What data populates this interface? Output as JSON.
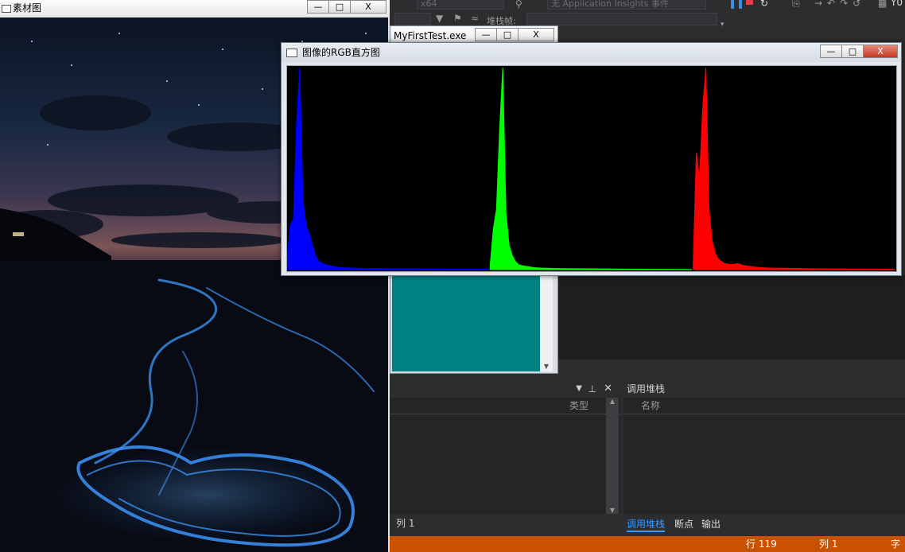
{
  "vs": {
    "platform": "x64",
    "insights": "无 Application Insights 事件",
    "stackframe_label": "堆栈帧:",
    "locals_col_type": "类型",
    "callstack_title": "调用堆栈",
    "callstack_col_name": "名称",
    "tabs": [
      "调用堆栈",
      "断点",
      "输出"
    ],
    "status_line": "行 119",
    "status_col": "列 1",
    "status_char": "字",
    "left_status": "列 1",
    "top_right_text": "Y0"
  },
  "console_window": {
    "title": "MyFirstTest.exe",
    "bg_color": "#008080"
  },
  "source_window": {
    "title": "素材图",
    "image_desc_icon": "beach-night-image"
  },
  "hist_window": {
    "title": "图像的RGB直方图",
    "colors": {
      "blue": "#0000ff",
      "green": "#00ff00",
      "red": "#ff0000"
    }
  },
  "window_buttons": {
    "minimize": "—",
    "maximize": "□",
    "close": "X"
  },
  "chart_data": {
    "type": "area",
    "title": "",
    "xlabel": "",
    "ylabel": "",
    "x": [
      0,
      4,
      8,
      12,
      16,
      20,
      24,
      28,
      32,
      36,
      40,
      48,
      56,
      64,
      80,
      96,
      128,
      160,
      200,
      255
    ],
    "xlim": [
      0,
      255
    ],
    "ylim": [
      0,
      1
    ],
    "series": [
      {
        "color": "#0000ff",
        "values": [
          0.05,
          0.22,
          0.25,
          0.72,
          1.0,
          0.35,
          0.22,
          0.18,
          0.12,
          0.07,
          0.04,
          0.025,
          0.018,
          0.012,
          0.008,
          0.006,
          0.005,
          0.004,
          0.003,
          0.002
        ]
      },
      {
        "color": "#00ff00",
        "values": [
          0.02,
          0.2,
          0.3,
          0.7,
          1.0,
          0.28,
          0.12,
          0.07,
          0.04,
          0.025,
          0.02,
          0.015,
          0.01,
          0.008,
          0.006,
          0.005,
          0.004,
          0.003,
          0.002,
          0.001
        ]
      },
      {
        "color": "#ff0000",
        "values": [
          0.03,
          0.58,
          0.45,
          0.8,
          1.0,
          0.3,
          0.14,
          0.08,
          0.05,
          0.04,
          0.03,
          0.025,
          0.03,
          0.02,
          0.012,
          0.008,
          0.006,
          0.004,
          0.003,
          0.002
        ]
      }
    ]
  }
}
